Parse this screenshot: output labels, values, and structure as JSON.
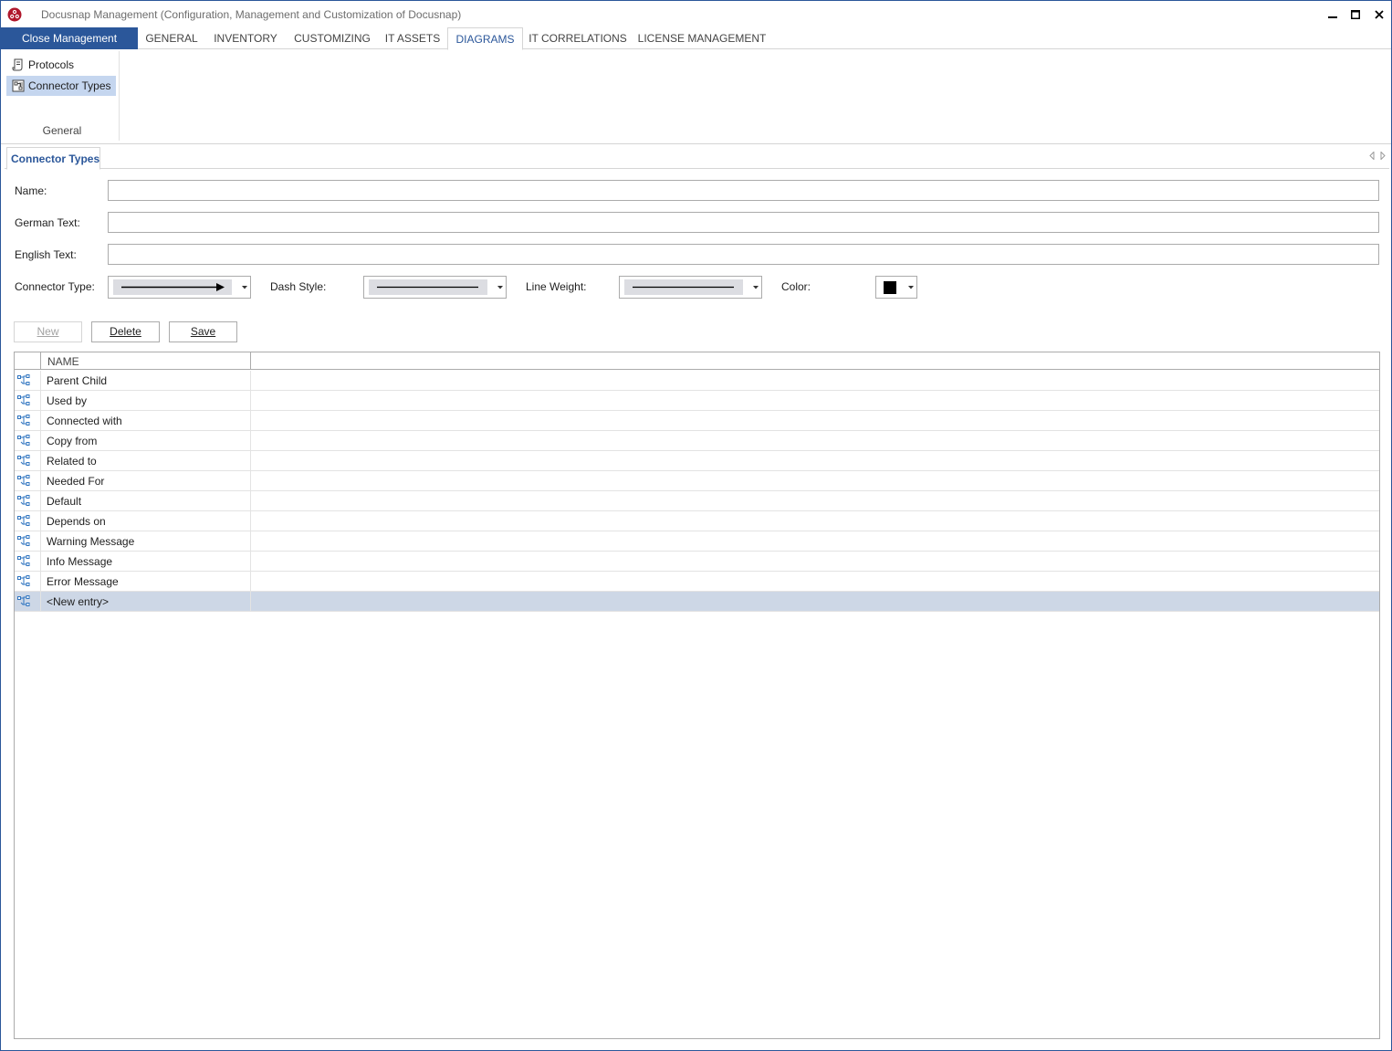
{
  "window": {
    "title": "Docusnap Management (Configuration, Management and Customization of Docusnap)",
    "controls": [
      "minimize",
      "maximize",
      "close"
    ]
  },
  "ribbon": {
    "close_label": "Close Management",
    "tabs": [
      {
        "label": "GENERAL",
        "active": false
      },
      {
        "label": "INVENTORY",
        "active": false
      },
      {
        "label": "CUSTOMIZING",
        "active": false
      },
      {
        "label": "IT ASSETS",
        "active": false
      },
      {
        "label": "DIAGRAMS",
        "active": true
      },
      {
        "label": "IT CORRELATIONS",
        "active": false
      },
      {
        "label": "LICENSE MANAGEMENT",
        "active": false
      }
    ],
    "group": {
      "label": "General",
      "items": [
        {
          "label": "Protocols",
          "icon": "protocols-icon",
          "selected": false
        },
        {
          "label": "Connector Types",
          "icon": "connector-types-icon",
          "selected": true
        }
      ]
    }
  },
  "document_tab": {
    "label": "Connector Types"
  },
  "form": {
    "name_label": "Name:",
    "name_value": "",
    "german_label": "German Text:",
    "german_value": "",
    "english_label": "English Text:",
    "english_value": "",
    "connector_type_label": "Connector Type:",
    "connector_type_value": "arrow",
    "dash_style_label": "Dash Style:",
    "dash_style_value": "solid",
    "line_weight_label": "Line Weight:",
    "line_weight_value": "thin",
    "color_label": "Color:",
    "color_value": "#000000"
  },
  "buttons": {
    "new": {
      "label": "New",
      "mnemonic": "N",
      "enabled": false
    },
    "delete": {
      "label": "Delete",
      "mnemonic": "D",
      "enabled": true
    },
    "save": {
      "label": "Save",
      "mnemonic": "S",
      "enabled": true
    }
  },
  "grid": {
    "columns": [
      "NAME"
    ],
    "rows": [
      {
        "name": "Parent Child"
      },
      {
        "name": "Used by"
      },
      {
        "name": "Connected with"
      },
      {
        "name": "Copy from"
      },
      {
        "name": "Related to"
      },
      {
        "name": "Needed For"
      },
      {
        "name": "Default"
      },
      {
        "name": "Depends on"
      },
      {
        "name": "Warning Message"
      },
      {
        "name": "Info Message"
      },
      {
        "name": "Error Message"
      },
      {
        "name": "<New entry>",
        "selected": true
      }
    ]
  },
  "colors": {
    "accent": "#2b579a",
    "selection": "#c5d6ef",
    "row_selection": "#cdd7e6"
  }
}
